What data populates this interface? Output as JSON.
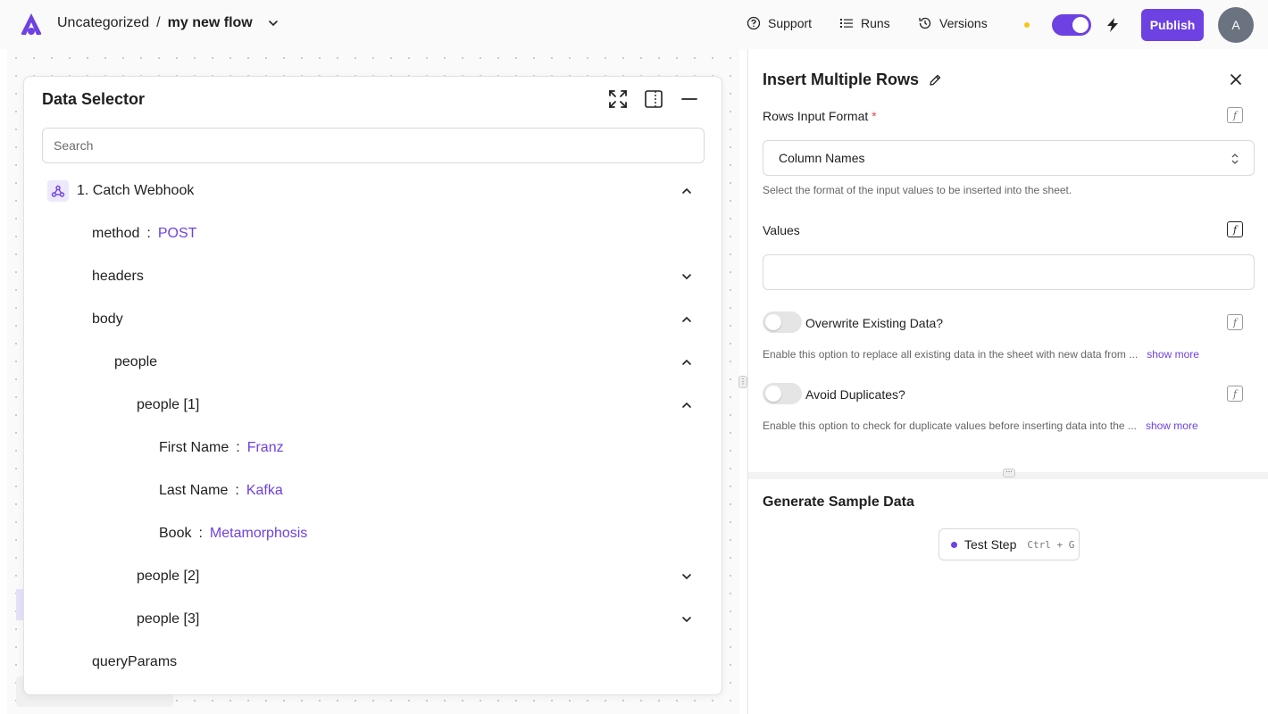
{
  "header": {
    "folder": "Uncategorized",
    "separator": "/",
    "flow_name": "my new flow",
    "support": "Support",
    "runs": "Runs",
    "versions": "Versions",
    "publish": "Publish",
    "avatar_initial": "A",
    "status_dot_color": "#f5c518",
    "toggle_on": true
  },
  "data_selector": {
    "title": "Data Selector",
    "search_placeholder": "Search",
    "rows": [
      {
        "key": "1. Catch Webhook",
        "value": "",
        "expanded": true
      },
      {
        "key": "method",
        "value": "POST"
      },
      {
        "key": "headers",
        "value": "",
        "expanded": false
      },
      {
        "key": "body",
        "value": "",
        "expanded": true
      },
      {
        "key": "people",
        "value": "",
        "expanded": true
      },
      {
        "key": "people [1]",
        "value": "",
        "expanded": true
      },
      {
        "key": "First Name",
        "value": "Franz"
      },
      {
        "key": "Last Name",
        "value": "Kafka"
      },
      {
        "key": "Book",
        "value": "Metamorphosis"
      },
      {
        "key": "people [2]",
        "value": "",
        "expanded": false
      },
      {
        "key": "people [3]",
        "value": "",
        "expanded": false
      },
      {
        "key": "queryParams",
        "value": ""
      }
    ]
  },
  "step_panel": {
    "title": "Insert Multiple Rows",
    "rows_input_format_label": "Rows Input Format",
    "required_mark": "*",
    "rows_input_format_value": "Column Names",
    "rows_input_format_help": "Select the format of the input values to be inserted into the sheet.",
    "values_label": "Values",
    "values_value": "",
    "overwrite_label": "Overwrite Existing Data?",
    "overwrite_help": "Enable this option to replace all existing data in the sheet with new data from ...",
    "avoid_dup_label": "Avoid Duplicates?",
    "avoid_dup_help": "Enable this option to check for duplicate values before inserting data into the ...",
    "show_more": "show more",
    "generate_title": "Generate Sample Data",
    "test_step": "Test Step",
    "test_shortcut": "Ctrl + G"
  },
  "colors": {
    "accent": "#6e41e2",
    "value_text": "#6e41e2"
  }
}
